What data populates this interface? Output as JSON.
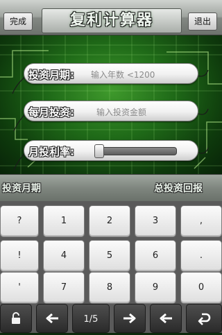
{
  "header": {
    "title": "复利计算器",
    "left_button": "完成",
    "right_button": "退出"
  },
  "form": {
    "period": {
      "label": "投资月期:",
      "placeholder": "输入年数 <1200"
    },
    "amount": {
      "label": "每月投资:",
      "placeholder": "输入投资金额"
    },
    "rate": {
      "label": "月投利率:",
      "value": 0
    }
  },
  "stats": {
    "left": "投资月期",
    "right": "总投资回报"
  },
  "keyboard": {
    "rows": [
      [
        "?",
        "1",
        "2",
        "3",
        ","
      ],
      [
        "!",
        "4",
        "5",
        "6",
        "."
      ],
      [
        "'",
        "7",
        "8",
        "9",
        "0"
      ]
    ],
    "function_row": {
      "lock": "lock-icon",
      "left": "arrow-left-icon",
      "page": "1/5",
      "right": "arrow-right-icon",
      "backspace": "backspace-icon",
      "enter": "return-icon"
    }
  },
  "colors": {
    "panel_green": "#2f8a22",
    "key_face": "#f4f4f4",
    "function_key": "#333333"
  }
}
